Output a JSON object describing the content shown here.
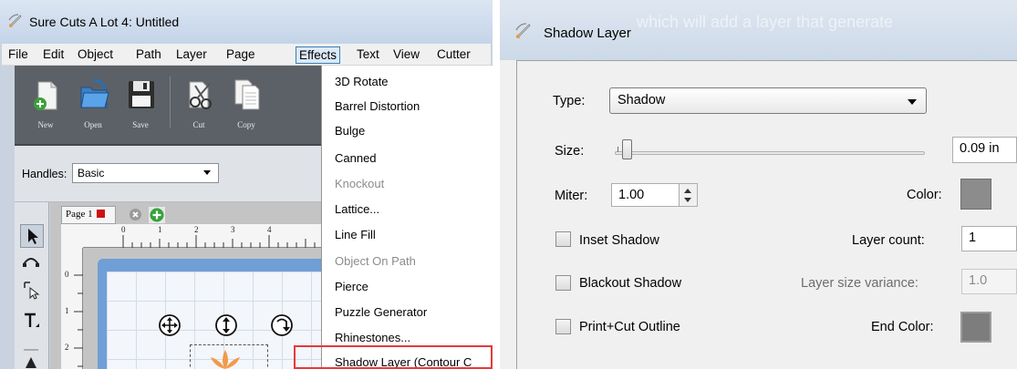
{
  "left_window": {
    "title": "Sure Cuts A Lot 4: Untitled",
    "menu": [
      "File",
      "Edit",
      "Object",
      "Path",
      "Layer",
      "Page",
      "Effects",
      "Text",
      "View",
      "Cutter"
    ],
    "active_menu": "Effects",
    "toolbar": [
      {
        "label": "New",
        "icon": "new-document-icon"
      },
      {
        "label": "Open",
        "icon": "open-folder-icon"
      },
      {
        "label": "Save",
        "icon": "save-disk-icon"
      },
      {
        "label": "Cut",
        "icon": "scissors-icon"
      },
      {
        "label": "Copy",
        "icon": "copy-icon"
      }
    ],
    "handles": {
      "label": "Handles:",
      "value": "Basic"
    },
    "page_tab": {
      "label": "Page 1"
    },
    "ruler_top": [
      "0",
      "1",
      "2",
      "3",
      "4"
    ],
    "ruler_left": [
      "0",
      "1",
      "2"
    ],
    "effects_menu": [
      {
        "label": "3D Rotate",
        "enabled": true
      },
      {
        "label": "Barrel Distortion",
        "enabled": true
      },
      {
        "label": "Bulge",
        "enabled": true
      },
      {
        "label": "Canned",
        "enabled": true
      },
      {
        "label": "Knockout",
        "enabled": false
      },
      {
        "label": "Lattice...",
        "enabled": true
      },
      {
        "label": "Line Fill",
        "enabled": true
      },
      {
        "label": "Object On Path",
        "enabled": false
      },
      {
        "label": "Pierce",
        "enabled": true
      },
      {
        "label": "Puzzle Generator",
        "enabled": true
      },
      {
        "label": "Rhinestones...",
        "enabled": true
      },
      {
        "label": "Shadow Layer (Contour C",
        "enabled": true,
        "highlighted": true
      }
    ]
  },
  "right_window": {
    "title": "Shadow Layer",
    "ghost_title_text": "which will add a layer that generate",
    "type": {
      "label": "Type:",
      "value": "Shadow"
    },
    "size": {
      "label": "Size:",
      "value": "0.09 in"
    },
    "miter": {
      "label": "Miter:",
      "value": "1.00"
    },
    "color": {
      "label": "Color:",
      "swatch": "#8c8c8c"
    },
    "inset_shadow": {
      "label": "Inset Shadow",
      "checked": false
    },
    "layer_count": {
      "label": "Layer count:",
      "value": "1"
    },
    "blackout_shadow": {
      "label": "Blackout Shadow",
      "checked": false
    },
    "layer_size_variance": {
      "label": "Layer size variance:",
      "value": "1.0"
    },
    "print_cut_outline": {
      "label": "Print+Cut Outline",
      "checked": false
    },
    "end_color": {
      "label": "End Color:",
      "swatch": "#7d7d7d"
    }
  }
}
